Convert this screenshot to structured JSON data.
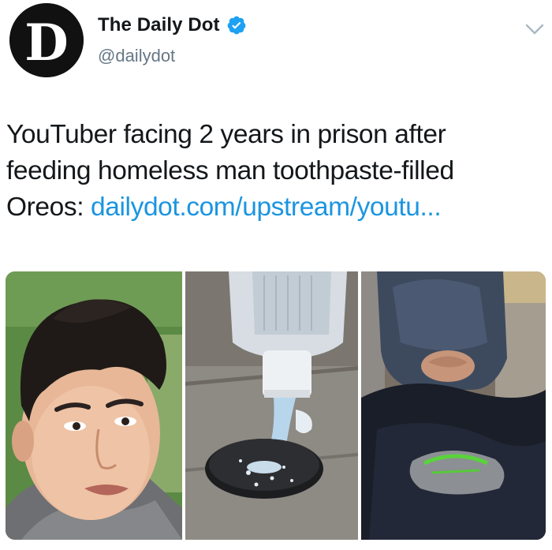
{
  "account": {
    "display_name": "The Daily Dot",
    "handle": "@dailydot",
    "avatar_letter": "D",
    "verified": true,
    "verified_color": "#1da1f2"
  },
  "tweet": {
    "text_line1": "YouTuber facing 2 years in prison after",
    "text_line2": "feeding homeless man toothpaste-filled",
    "text_line3_prefix": "Oreos: ",
    "link": "dailydot.com/upstream/youtu..."
  },
  "media": [
    {
      "icon": "photo-man-face"
    },
    {
      "icon": "photo-toothpaste-oreo"
    },
    {
      "icon": "photo-homeless-man-sitting"
    }
  ],
  "colors": {
    "link": "#1b95e0",
    "handle": "#657786",
    "text": "#14171a"
  },
  "icons": {
    "menu": "chevron-down-icon",
    "verified": "verified-badge-icon"
  }
}
